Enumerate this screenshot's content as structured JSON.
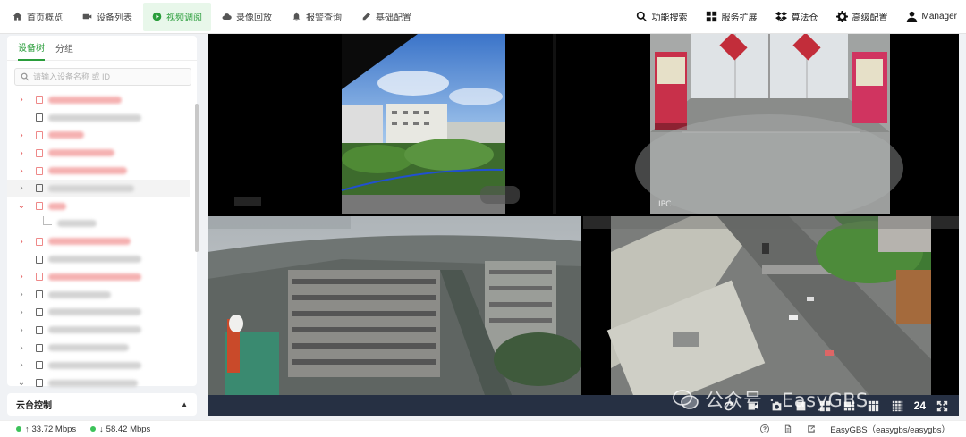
{
  "nav": {
    "items": [
      {
        "label": "首页概览",
        "icon": "home-icon"
      },
      {
        "label": "设备列表",
        "icon": "camera-icon"
      },
      {
        "label": "视频调阅",
        "icon": "play-circle-icon",
        "active": true
      },
      {
        "label": "录像回放",
        "icon": "cloud-icon"
      },
      {
        "label": "报警查询",
        "icon": "bell-icon"
      },
      {
        "label": "基础配置",
        "icon": "edit-icon"
      }
    ],
    "right": [
      {
        "label": "功能搜索",
        "icon": "search-icon"
      },
      {
        "label": "服务扩展",
        "icon": "grid-icon"
      },
      {
        "label": "算法仓",
        "icon": "dropbox-icon"
      },
      {
        "label": "高级配置",
        "icon": "gear-icon"
      },
      {
        "label": "Manager",
        "icon": "user-icon"
      }
    ]
  },
  "sidebar": {
    "tabs": [
      "设备树",
      "分组"
    ],
    "active_tab": "设备树",
    "search_placeholder": "请输入设备名称 或 ID",
    "ptz_label": "云台控制"
  },
  "video": {
    "cell2_osd": "IPC",
    "layout_count": "24"
  },
  "watermark": "公众号 · EasyGBS",
  "status": {
    "upload": "33.72 Mbps",
    "download": "58.42 Mbps",
    "version": "EasyGBS（easygbs/easygbs）"
  },
  "colors": {
    "accent": "#2a9d3b",
    "active_nav_bg": "#e8f7ea",
    "tree_offline": "#e24b4b",
    "control_bar": "#263043",
    "selected_cell_border": "#d5b146"
  }
}
